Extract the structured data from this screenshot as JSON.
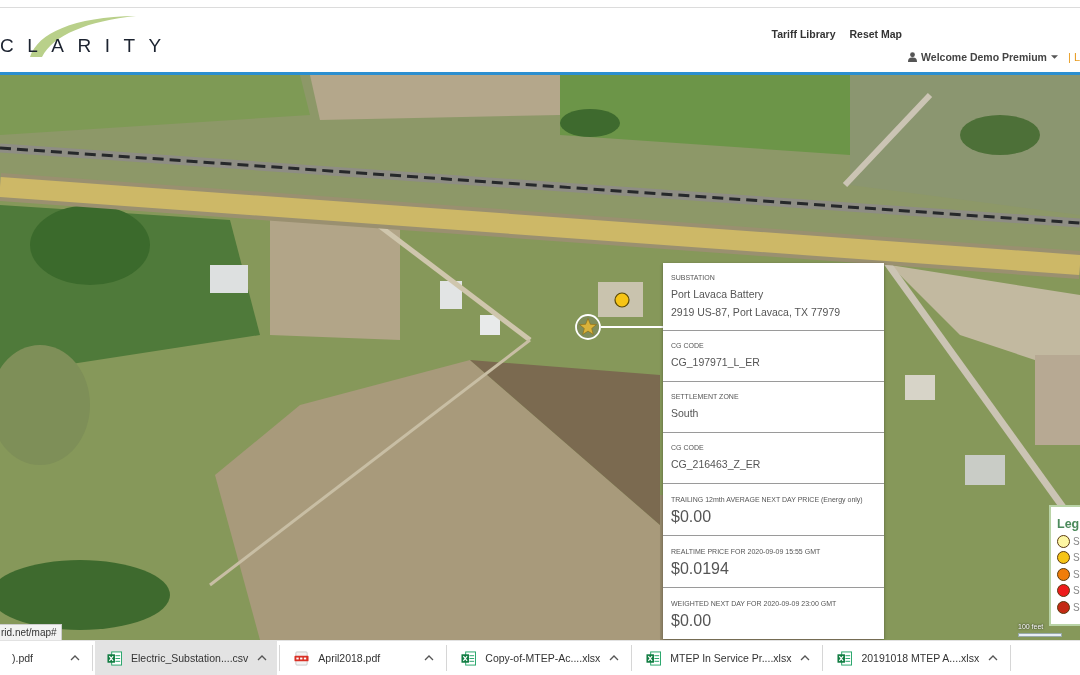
{
  "header": {
    "logo": "CLARITY",
    "nav_links": [
      "Tariff Library",
      "Reset Map"
    ],
    "user_menu": "Welcome Demo Premium",
    "logout_link": "| L"
  },
  "map": {
    "popup": {
      "sections": [
        {
          "label": "SUBSTATION",
          "lines": [
            "Port Lavaca Battery",
            "2919 US-87, Port Lavaca, TX 77979"
          ],
          "kind": "text"
        },
        {
          "label": "CG CODE",
          "lines": [
            "CG_197971_L_ER"
          ],
          "kind": "text"
        },
        {
          "label": "SETTLEMENT ZONE",
          "lines": [
            "South"
          ],
          "kind": "text"
        },
        {
          "label": "CG CODE",
          "lines": [
            "CG_216463_Z_ER"
          ],
          "kind": "text"
        },
        {
          "label": "TRAILING 12mth AVERAGE NEXT DAY PRICE (Energy only)",
          "lines": [
            "$0.00"
          ],
          "kind": "price"
        },
        {
          "label": "REALTIME PRICE FOR 2020-09-09 15:55 GMT",
          "lines": [
            "$0.0194"
          ],
          "kind": "price"
        },
        {
          "label": "WEIGHTED NEXT DAY FOR 2020-09-09 23:00 GMT",
          "lines": [
            "$0.00"
          ],
          "kind": "price"
        }
      ]
    },
    "legend": {
      "title": "Leg",
      "items": [
        {
          "label": "S",
          "color": "#fdf6a3"
        },
        {
          "label": "S",
          "color": "#f6c416"
        },
        {
          "label": "S",
          "color": "#ef7d0a"
        },
        {
          "label": "S",
          "color": "#ee1c1c"
        },
        {
          "label": "S",
          "color": "#c42a14"
        }
      ]
    },
    "scale": "100 feet",
    "status_url": "rid.net/map#"
  },
  "downloads": [
    {
      "name": ").pdf",
      "selected": false
    },
    {
      "name": "Electric_Substation....csv",
      "kind": "spreadsheet",
      "selected": true
    },
    {
      "name": "April2018.pdf",
      "kind": "pdf",
      "selected": false
    },
    {
      "name": "Copy-of-MTEP-Ac....xlsx",
      "kind": "spreadsheet",
      "selected": false
    },
    {
      "name": "MTEP In Service Pr....xlsx",
      "kind": "spreadsheet",
      "selected": false
    },
    {
      "name": "20191018 MTEP A....xlsx",
      "kind": "spreadsheet",
      "selected": false
    }
  ]
}
